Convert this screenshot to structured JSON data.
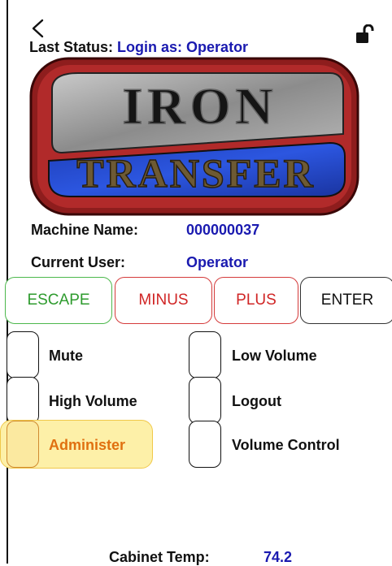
{
  "header": {
    "last_status_label": "Last Status:",
    "last_status_value": "Login as: Operator"
  },
  "logo": {
    "alt": "IRON TRANSFER"
  },
  "machine": {
    "name_label": "Machine Name:",
    "name_value": "000000037",
    "user_label": "Current User:",
    "user_value": "Operator"
  },
  "buttons": {
    "escape": "ESCAPE",
    "minus": "MINUS",
    "plus": "PLUS",
    "enter": "ENTER"
  },
  "options": {
    "mute": "Mute",
    "low_volume": "Low Volume",
    "high_volume": "High Volume",
    "logout": "Logout",
    "administer": "Administer",
    "volume_control": "Volume Control"
  },
  "footer": {
    "cabinet_temp_label": "Cabinet Temp:",
    "cabinet_temp_value": "74.2"
  },
  "colors": {
    "status_value": "#1a1ab0",
    "escape": "#2e9b2e",
    "minus_plus": "#d02525",
    "highlight": "#fdf0a8",
    "administer": "#e07010"
  },
  "icons": [
    "back-chevron-icon",
    "unlock-icon"
  ]
}
